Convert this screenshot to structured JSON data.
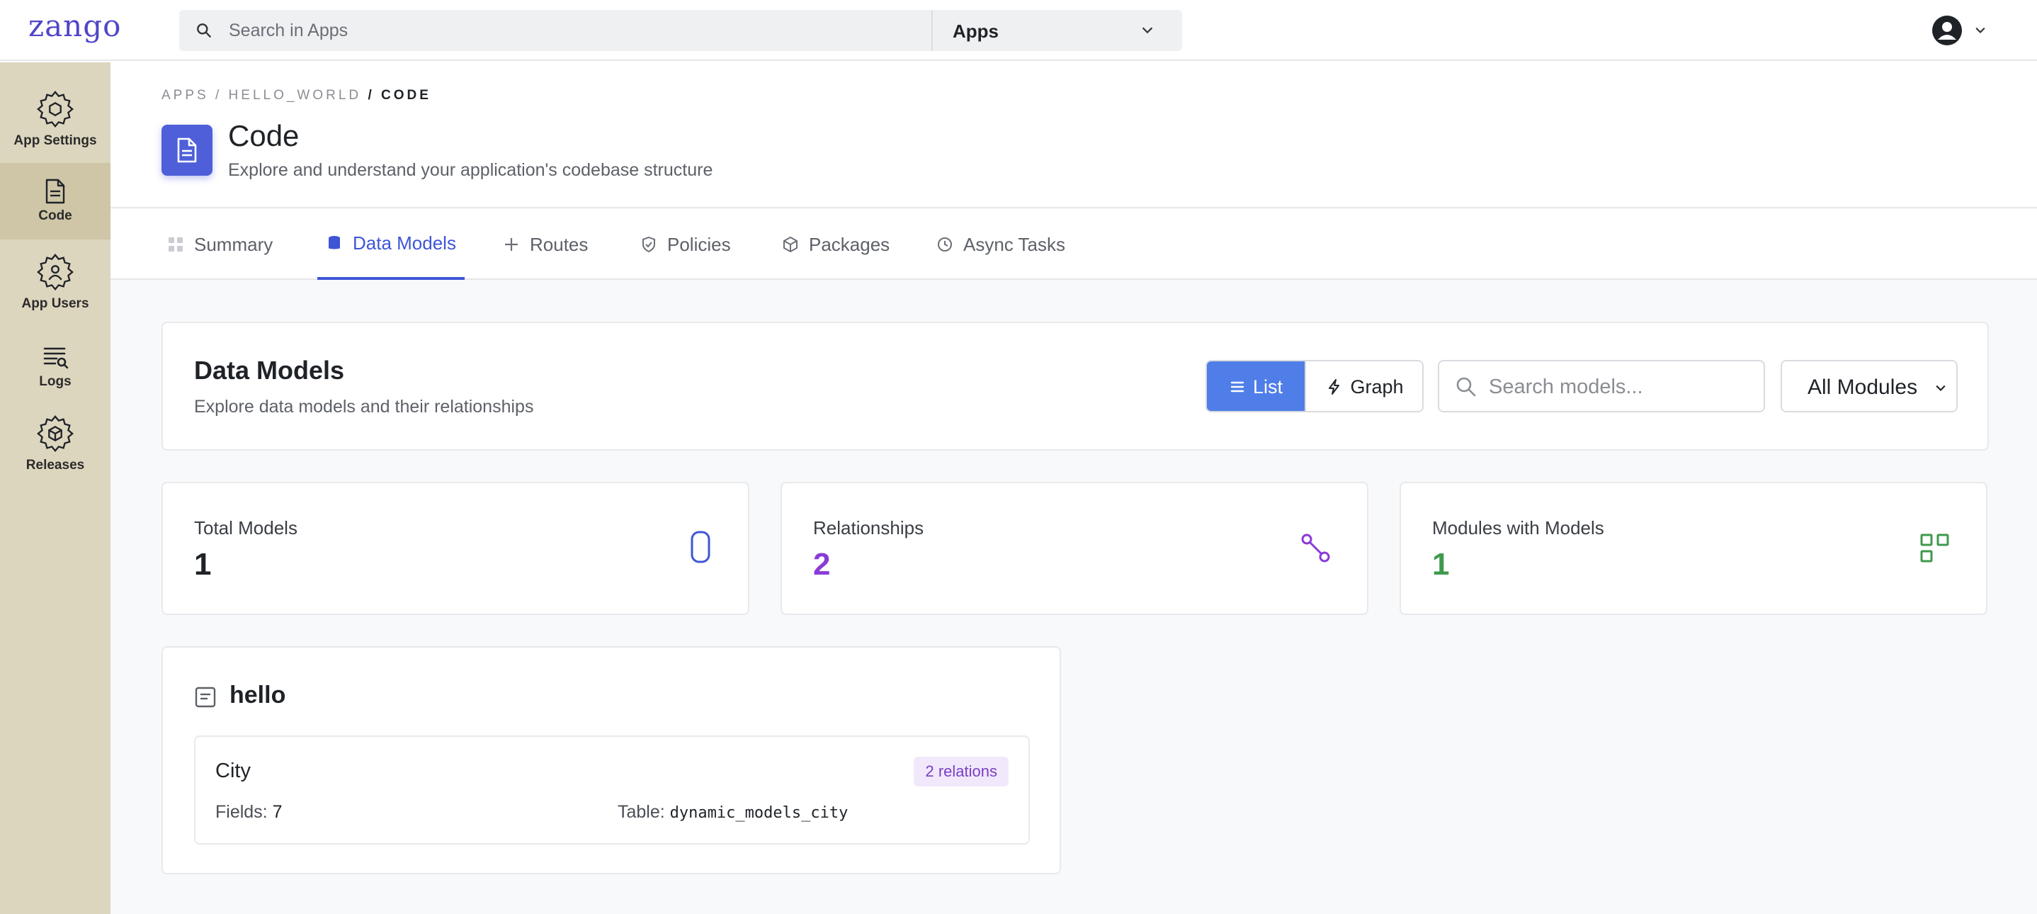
{
  "brand": {
    "logo_text": "zango"
  },
  "topbar": {
    "search_placeholder": "Search in Apps",
    "apps_select": "Apps"
  },
  "sidebar": {
    "items": [
      {
        "label": "App Settings",
        "icon": "gear-icon"
      },
      {
        "label": "Code",
        "icon": "file-icon",
        "active": true
      },
      {
        "label": "App Users",
        "icon": "users-gear-icon"
      },
      {
        "label": "Logs",
        "icon": "logs-icon"
      },
      {
        "label": "Releases",
        "icon": "package-gear-icon"
      }
    ]
  },
  "header": {
    "breadcrumb": [
      "APPS",
      "HELLO_WORLD",
      "CODE"
    ],
    "title": "Code",
    "subtitle": "Explore and understand your application's codebase structure"
  },
  "tabs": [
    {
      "label": "Summary",
      "icon": "grid-icon"
    },
    {
      "label": "Data Models",
      "icon": "database-icon",
      "active": true
    },
    {
      "label": "Routes",
      "icon": "plus-icon"
    },
    {
      "label": "Policies",
      "icon": "shield-icon"
    },
    {
      "label": "Packages",
      "icon": "box-icon"
    },
    {
      "label": "Async Tasks",
      "icon": "clock-icon"
    }
  ],
  "data_models": {
    "title": "Data Models",
    "subtitle": "Explore data models and their relationships",
    "view_list": "List",
    "view_graph": "Graph",
    "search_placeholder": "Search models...",
    "module_filter": "All Modules"
  },
  "stats": [
    {
      "label": "Total Models",
      "value": "1",
      "color": "#1f2328",
      "icon": "database-outline-icon"
    },
    {
      "label": "Relationships",
      "value": "2",
      "color": "#8a3ad6",
      "icon": "link-nodes-icon"
    },
    {
      "label": "Modules with Models",
      "value": "1",
      "color": "#3f9a4c",
      "icon": "grid-outline-icon"
    }
  ],
  "modules": [
    {
      "name": "hello",
      "models": [
        {
          "name": "City",
          "relations_badge": "2 relations",
          "fields_label": "Fields:",
          "fields_count": "7",
          "table_label": "Table:",
          "table_name": "dynamic_models_city"
        }
      ]
    }
  ],
  "colors": {
    "accent": "#3e56d6",
    "sidebar_bg": "#ddd6bf",
    "list_button": "#4f7ee8"
  }
}
